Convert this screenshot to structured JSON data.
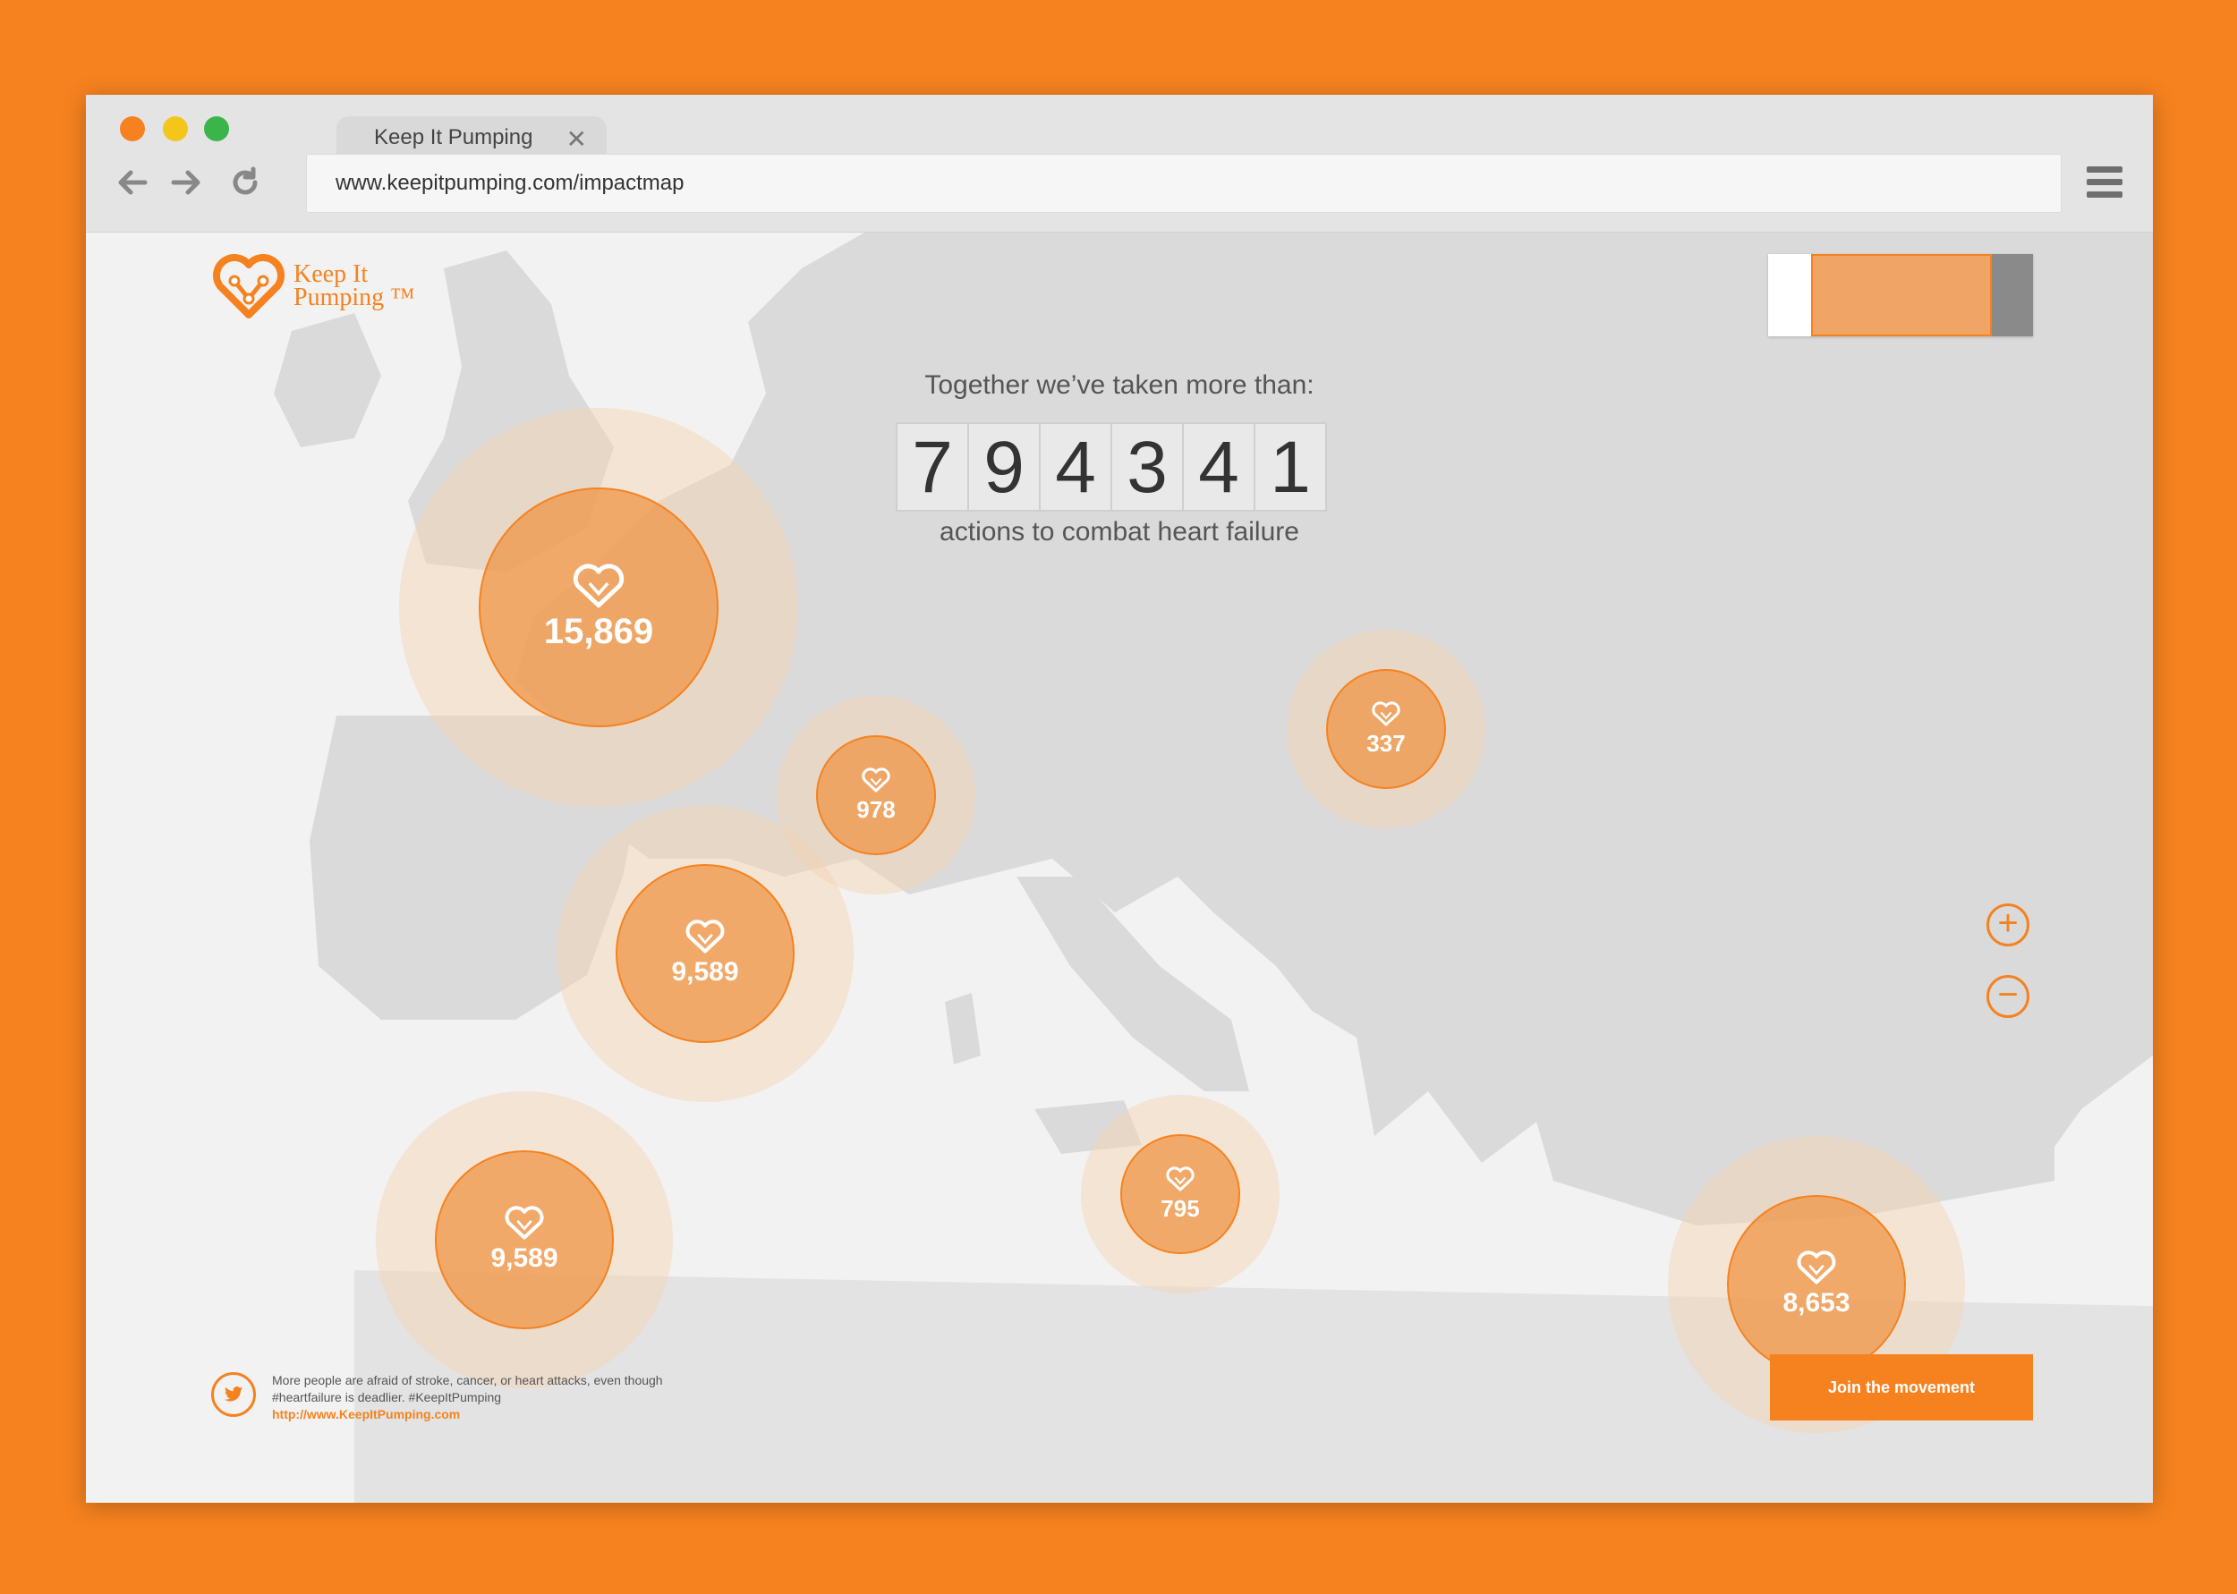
{
  "browser": {
    "tab_title": "Keep It Pumping",
    "tab_close": "✕",
    "url": "www.keepitpumping.com/impactmap",
    "back_icon": "arrow-left-icon",
    "forward_icon": "arrow-right-icon",
    "reload_icon": "reload-icon",
    "menu_icon": "hamburger-menu-icon"
  },
  "logo": {
    "line1": "Keep It",
    "line2": "Pumping ™"
  },
  "headline": {
    "intro": "Together we’ve taken more than:",
    "digits": [
      "7",
      "9",
      "4",
      "3",
      "4",
      "1"
    ],
    "outro": "actions to combat heart failure"
  },
  "bubbles": [
    {
      "id": "uk",
      "value": "15,869"
    },
    {
      "id": "benelux",
      "value": "978"
    },
    {
      "id": "poland",
      "value": "337"
    },
    {
      "id": "france",
      "value": "9,589"
    },
    {
      "id": "spain",
      "value": "9,589"
    },
    {
      "id": "italy",
      "value": "795"
    },
    {
      "id": "turkey",
      "value": "8,653"
    }
  ],
  "zoom": {
    "in": "+",
    "out": "−"
  },
  "tweet": {
    "text": "More people are afraid of stroke, cancer, or heart attacks, even though #heartfailure is deadlier. #KeepItPumping",
    "link": "http://www.KeepItPumping.com"
  },
  "cta": {
    "label": "Join the movement"
  },
  "colors": {
    "accent": "#f5821f",
    "background": "#f5821f",
    "map_land": "#dadada",
    "map_sea": "#f2f2f2"
  }
}
